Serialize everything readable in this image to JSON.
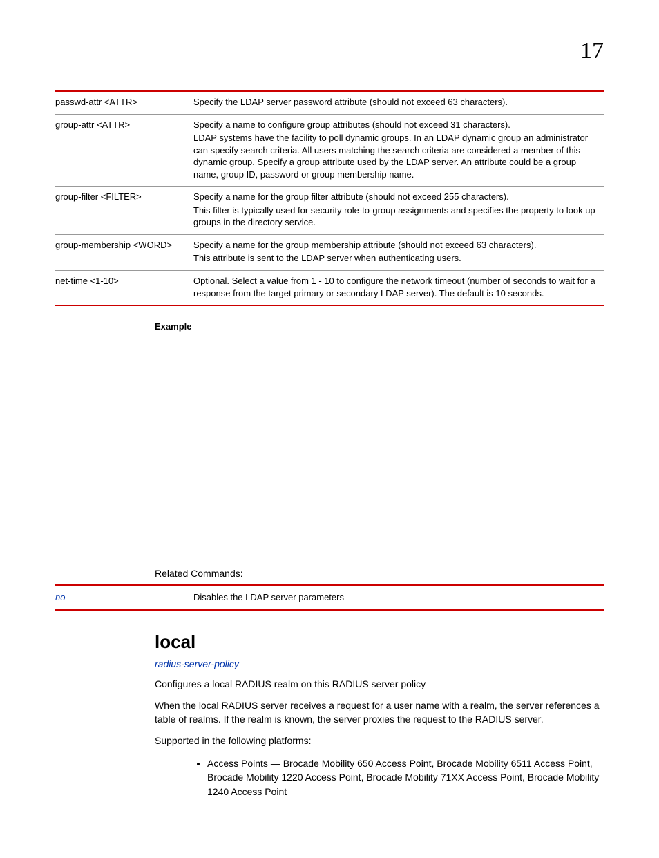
{
  "chapter_number": "17",
  "params_table": {
    "rows": [
      {
        "param": "passwd-attr <ATTR>",
        "desc": [
          "Specify the LDAP server password attribute (should not exceed 63 characters)."
        ]
      },
      {
        "param": "group-attr <ATTR>",
        "desc": [
          "Specify a name to configure group attributes (should not exceed 31 characters).",
          "LDAP systems have the facility to poll dynamic groups. In an LDAP dynamic group an administrator can specify search criteria. All users matching the search criteria are considered a member of this dynamic group. Specify a group attribute used by the LDAP server. An attribute could be a group name, group ID, password or group membership name."
        ]
      },
      {
        "param": "group-filter <FILTER>",
        "desc": [
          "Specify a name for the group filter attribute (should not exceed 255 characters).",
          "This filter is typically used for security role-to-group assignments and specifies the property to look up groups in the directory service."
        ]
      },
      {
        "param": "group-membership <WORD>",
        "desc": [
          "Specify a name for the group membership attribute (should not exceed 63 characters).",
          "This attribute is sent to the LDAP server when authenticating users."
        ]
      },
      {
        "param": "net-time <1-10>",
        "desc": [
          "Optional. Select a value from 1 - 10 to configure the network timeout (number of seconds to wait for a response from the target primary or secondary LDAP server). The default is 10 seconds."
        ]
      }
    ]
  },
  "example_label": "Example",
  "related_heading": "Related Commands:",
  "related_table": {
    "rows": [
      {
        "cmd": "no",
        "desc": "Disables the LDAP server parameters"
      }
    ]
  },
  "cmd_section": {
    "heading": "local",
    "link": "radius-server-policy",
    "p1": "Configures a local RADIUS realm on this RADIUS server policy",
    "p2": "When the local RADIUS server receives a request for a user name with a realm, the server references a table of realms. If the realm is known, the server proxies the request to the RADIUS server.",
    "p3": "Supported in the following platforms:",
    "bullets": [
      "Access Points — Brocade Mobility 650 Access Point, Brocade Mobility 6511 Access Point, Brocade Mobility 1220 Access Point, Brocade Mobility 71XX Access Point, Brocade Mobility 1240 Access Point"
    ]
  }
}
